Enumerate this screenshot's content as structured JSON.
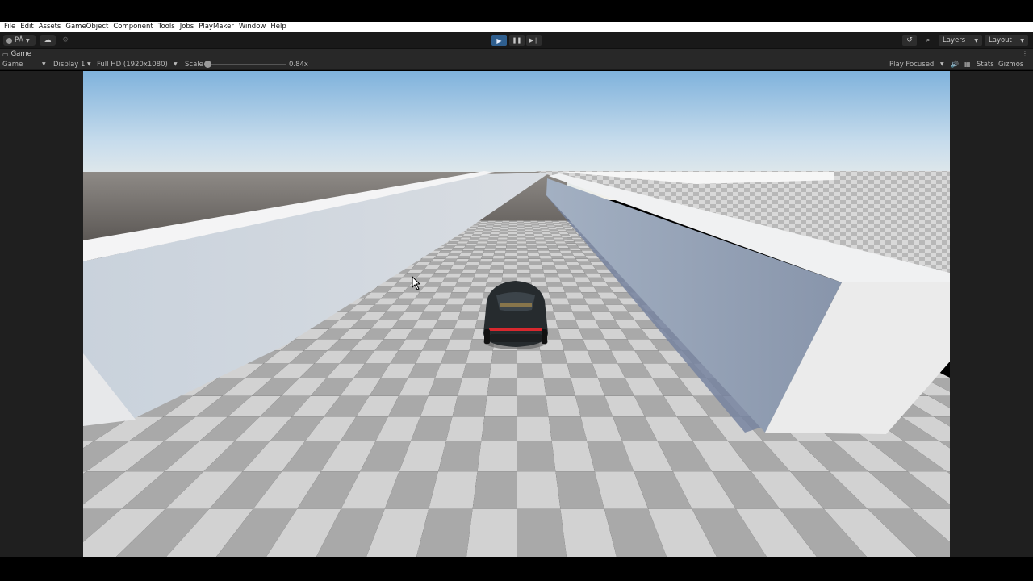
{
  "menu": {
    "items": [
      "File",
      "Edit",
      "Assets",
      "GameObject",
      "Component",
      "Tools",
      "Jobs",
      "PlayMaker",
      "Window",
      "Help"
    ]
  },
  "toolbar": {
    "account_label": "PÅ",
    "play_icon": "play-icon",
    "pause_icon": "pause-icon",
    "step_icon": "step-icon",
    "layers_label": "Layers",
    "layout_label": "Layout",
    "play_active_color": "#2f5f8f"
  },
  "tab": {
    "label": "Game"
  },
  "gamebar": {
    "mode": "Game",
    "display": "Display 1",
    "resolution": "Full HD (1920x1080)",
    "scale_label": "Scale",
    "scale_value": "0.84x",
    "scale_fraction": 0.0,
    "play_mode": "Play Focused",
    "stats": "Stats",
    "gizmos": "Gizmos"
  },
  "scene": {
    "sky_top": "#7fb2dc",
    "sky_horizon": "#f3f1ea",
    "car_tail_light": "#d8282e"
  }
}
